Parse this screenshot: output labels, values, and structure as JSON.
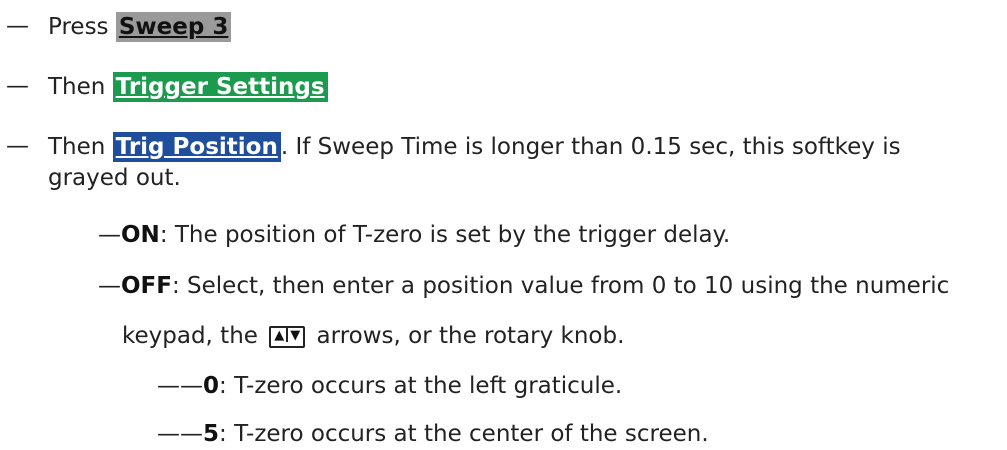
{
  "steps": [
    {
      "dash": "—",
      "prefix": "Press ",
      "key": "Sweep 3",
      "suffix": ""
    },
    {
      "dash": "—",
      "prefix": "Then ",
      "key": "Trigger Settings",
      "suffix": ""
    },
    {
      "dash": "—",
      "prefix": "Then ",
      "key": "Trig Position",
      "suffix": ". If Sweep Time is longer than 0.15 sec, this softkey is",
      "continuation": "grayed out."
    }
  ],
  "options": [
    {
      "dash": "—",
      "term": "ON",
      "text": ": The position of T-zero is set by the trigger delay."
    },
    {
      "dash": "—",
      "term": "OFF",
      "text": ": Select, then enter a position value from 0 to 10 using the numeric",
      "continuation_a": "keypad, the ",
      "arrow_glyph_up": "▲",
      "arrow_glyph_down": "▼",
      "continuation_b": " arrows, or the rotary knob."
    }
  ],
  "suboptions": [
    {
      "dash": "——",
      "term": "0",
      "text": ": T-zero occurs at the left graticule."
    },
    {
      "dash": "——",
      "term": "5",
      "text": ": T-zero occurs at the center of the screen."
    }
  ],
  "icons": {
    "arrow_keys": "up-down-arrow-keys-icon"
  },
  "colors": {
    "sweep_key_bg": "#9a9a9a",
    "trigger_key_bg": "#1c9a4e",
    "trig_pos_key_bg": "#1f4f9c"
  }
}
